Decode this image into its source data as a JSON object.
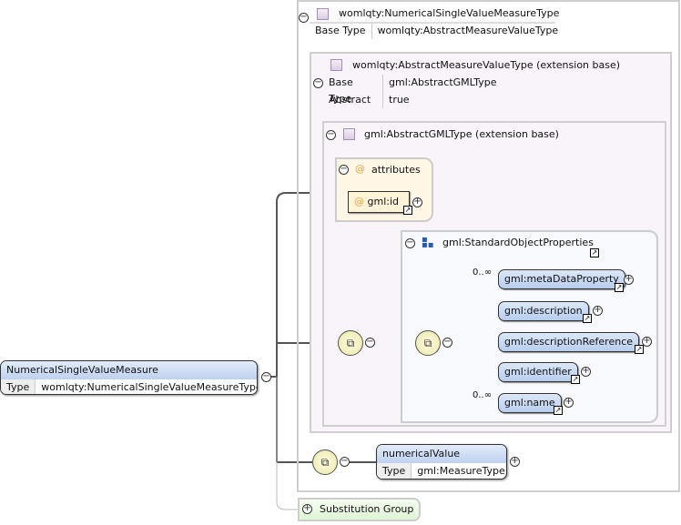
{
  "root_element": {
    "name": "NumericalSingleValueMeasure",
    "type_label": "Type",
    "type": "womlqty:NumericalSingleValueMeasureType"
  },
  "complex_type": {
    "name": "womlqty:NumericalSingleValueMeasureType",
    "base_label": "Base Type",
    "base": "womlqty:AbstractMeasureValueType"
  },
  "extension1": {
    "name": "womlqty:AbstractMeasureValueType (extension base)",
    "base_label": "Base Type",
    "base": "gml:AbstractGMLType",
    "abstract_label": "Abstract",
    "abstract": "true"
  },
  "extension2": {
    "name": "gml:AbstractGMLType (extension base)"
  },
  "attributes": {
    "label": "attributes",
    "items": [
      "gml:id"
    ]
  },
  "group": {
    "name": "gml:StandardObjectProperties",
    "items": [
      {
        "name": "gml:metaDataProperty",
        "occurs": "0..∞"
      },
      {
        "name": "gml:description"
      },
      {
        "name": "gml:descriptionReference"
      },
      {
        "name": "gml:identifier"
      },
      {
        "name": "gml:name",
        "occurs": "0..∞"
      }
    ]
  },
  "numerical_value": {
    "name": "numericalValue",
    "type_label": "Type",
    "type": "gml:MeasureType"
  },
  "substitution_group": {
    "label": "Substitution Group"
  }
}
